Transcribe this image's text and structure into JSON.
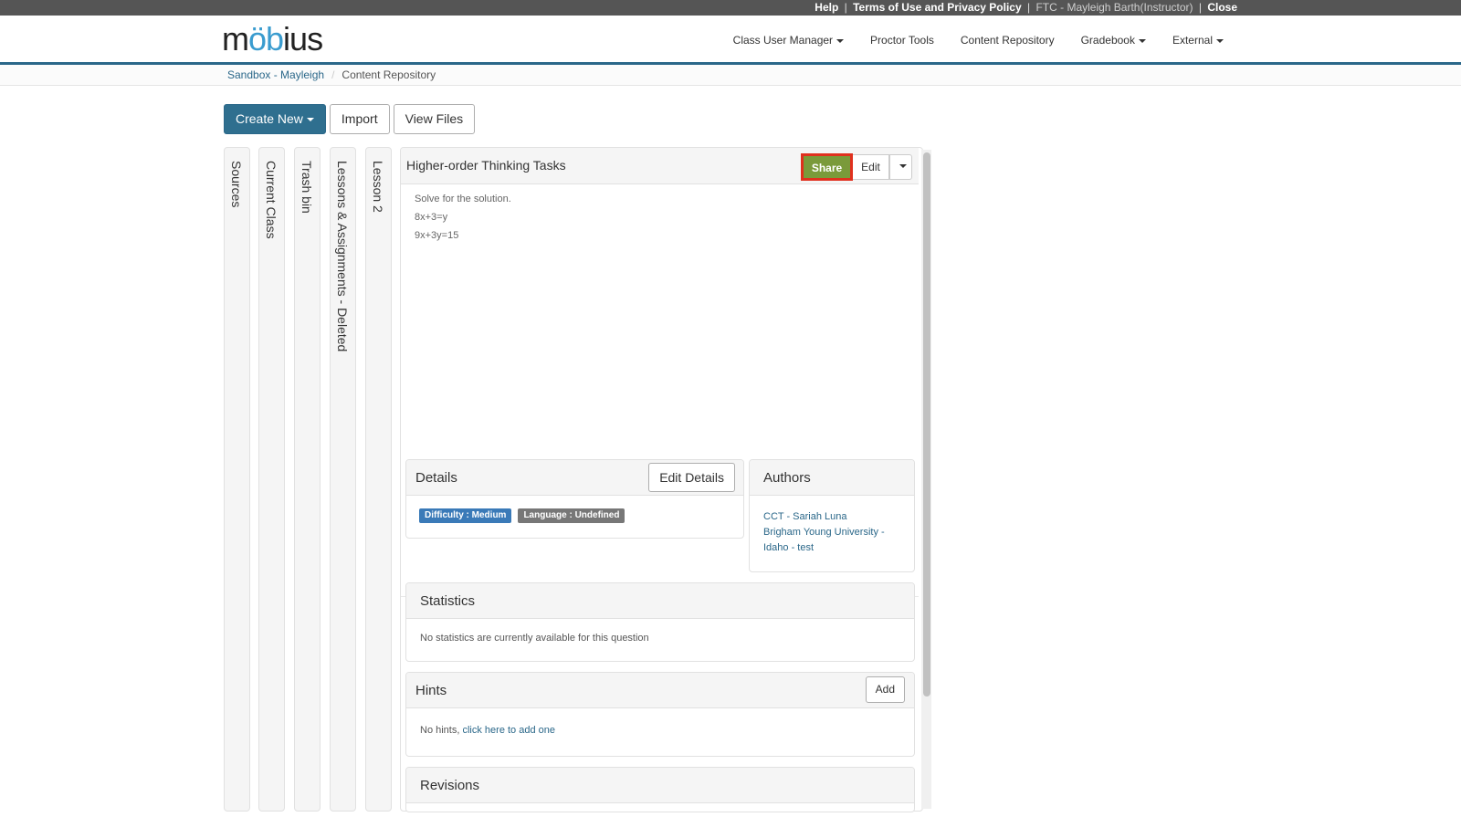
{
  "topbar": {
    "help": "Help",
    "terms": "Terms of Use and Privacy Policy",
    "user": "FTC - Mayleigh Barth(Instructor)",
    "close": "Close",
    "separator": "|"
  },
  "header": {
    "logo": {
      "prefix": "m",
      "accent": "öb",
      "suffix": "ius"
    },
    "nav": [
      {
        "label": "Class User Manager",
        "dropdown": true
      },
      {
        "label": "Proctor Tools",
        "dropdown": false
      },
      {
        "label": "Content Repository",
        "dropdown": false
      },
      {
        "label": "Gradebook",
        "dropdown": true
      },
      {
        "label": "External",
        "dropdown": true
      }
    ],
    "accent_color": "#2a6789"
  },
  "breadcrumb": [
    {
      "label": "Sandbox - Mayleigh",
      "link": true
    },
    {
      "label": "Content Repository",
      "link": false
    }
  ],
  "toolbar": {
    "create_new": "Create New",
    "import": "Import",
    "view_files": "View Files"
  },
  "vertical_tabs": [
    {
      "label": "Sources"
    },
    {
      "label": "Current Class"
    },
    {
      "label": "Trash bin"
    },
    {
      "label": "Lessons & Assignments - Deleted"
    },
    {
      "label": "Lesson 2"
    }
  ],
  "question": {
    "title": "Higher-order Thinking Tasks",
    "share": "Share",
    "edit": "Edit",
    "lines": [
      "Solve for the solution.",
      "8x+3=y",
      "9x+3y=15"
    ]
  },
  "details": {
    "title": "Details",
    "edit_button": "Edit Details",
    "badges": [
      {
        "label": "Difficulty : Medium",
        "color": "#3a7ab8"
      },
      {
        "label": "Language : Undefined",
        "color": "#777777"
      }
    ]
  },
  "authors": {
    "title": "Authors",
    "entries": [
      "CCT - Sariah Luna",
      "Brigham Young University -",
      "Idaho - test"
    ]
  },
  "statistics": {
    "title": "Statistics",
    "message": "No statistics are currently available for this question"
  },
  "hints": {
    "title": "Hints",
    "add_button": "Add",
    "message": "No hints,",
    "link": "click here to add one"
  },
  "revisions": {
    "title": "Revisions"
  }
}
